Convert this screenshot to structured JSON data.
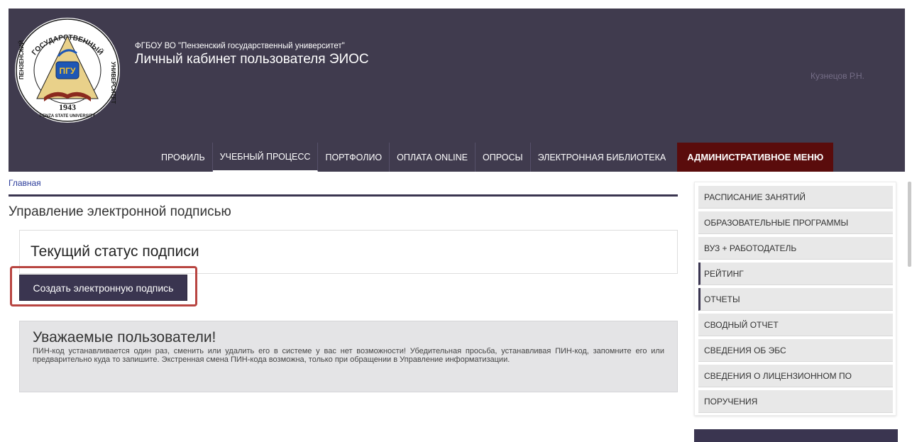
{
  "header": {
    "logo": {
      "top_arc": "ГОСУДАРСТВЕННЫЙ",
      "left_arc": "ПЕНЗЕНСКИЙ",
      "right_arc": "УНИВЕРСИТЕТ",
      "shield_text": "ПГУ",
      "year": "1943",
      "bottom_text": "PENZA STATE UNIVERSITY"
    },
    "university_name": "ФГБОУ ВО \"Пензенский государственный университет\"",
    "cabinet_title": "Личный кабинет пользователя ЭИОС",
    "user_name": "Кузнецов Р.Н."
  },
  "nav": {
    "items": [
      {
        "label": "ПРОФИЛЬ"
      },
      {
        "label": "УЧЕБНЫЙ ПРОЦЕСС"
      },
      {
        "label": "ПОРТФОЛИО"
      },
      {
        "label": "ОПЛАТА ONLINE"
      },
      {
        "label": "ОПРОСЫ"
      },
      {
        "label": "ЭЛЕКТРОННАЯ БИБЛИОТЕКА"
      },
      {
        "label": "АДМИНИСТРАТИВНОЕ МЕНЮ"
      }
    ]
  },
  "breadcrumb": "Главная",
  "page_title": "Управление электронной подписью",
  "status_panel": {
    "title": "Текущий статус подписи"
  },
  "create_button_label": "Создать электронную подпись",
  "notice": {
    "title": "Уважаемые пользователи!",
    "text": "ПИН-код устанавливается один раз, сменить или удалить его в системе у вас нет возможности! Убедительная просьба, устанавливая ПИН-код, запомните его или предварительно куда то запишите. Экстренная смена ПИН-кода возможна, только при обращении в Управление информатизации."
  },
  "side_menu": {
    "items": [
      {
        "label": "РАСПИСАНИЕ ЗАНЯТИЙ"
      },
      {
        "label": "ОБРАЗОВАТЕЛЬНЫЕ ПРОГРАММЫ"
      },
      {
        "label": "ВУЗ + РАБОТОДАТЕЛЬ"
      },
      {
        "label": "РЕЙТИНГ"
      },
      {
        "label": "ОТЧЕТЫ"
      },
      {
        "label": "СВОДНЫЙ ОТЧЕТ"
      },
      {
        "label": "СВЕДЕНИЯ ОБ ЭБС"
      },
      {
        "label": "СВЕДЕНИЯ О ЛИЦЕНЗИОННОМ ПО"
      },
      {
        "label": "ПОРУЧЕНИЯ"
      }
    ]
  },
  "colors": {
    "header_bg": "#403b4e",
    "admin_menu_bg": "#5a0c0c",
    "button_bg": "#3a3550",
    "highlight": "#b84541"
  }
}
